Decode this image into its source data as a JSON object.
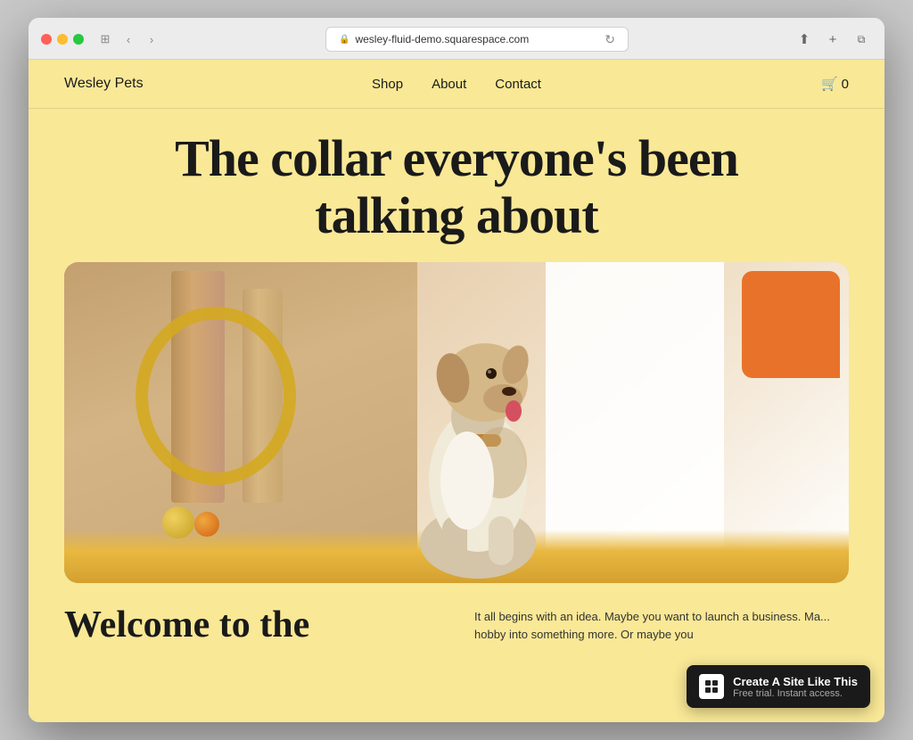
{
  "browser": {
    "url": "wesley-fluid-demo.squarespace.com",
    "reload_title": "Reload page"
  },
  "site": {
    "logo": "Wesley Pets",
    "nav": {
      "links": [
        {
          "label": "Shop",
          "href": "#"
        },
        {
          "label": "About",
          "href": "#"
        },
        {
          "label": "Contact",
          "href": "#"
        }
      ]
    },
    "cart_count": "0",
    "hero": {
      "title_line1": "The collar everyone's been",
      "title_line2": "talking about"
    },
    "welcome": {
      "heading_line1": "Welcome to the"
    },
    "body_text": "It all begins with an idea. Maybe you want to launch a business. Ma... hobby into something more. Or maybe you"
  },
  "squarespace_banner": {
    "logo_char": "■",
    "title": "Create A Site Like This",
    "subtitle": "Free trial. Instant access."
  },
  "icons": {
    "back": "‹",
    "forward": "›",
    "reload": "↻",
    "lock": "🔒",
    "share": "⬆",
    "new_tab": "+",
    "tab_grid": "⊞",
    "cart": "🛒"
  }
}
